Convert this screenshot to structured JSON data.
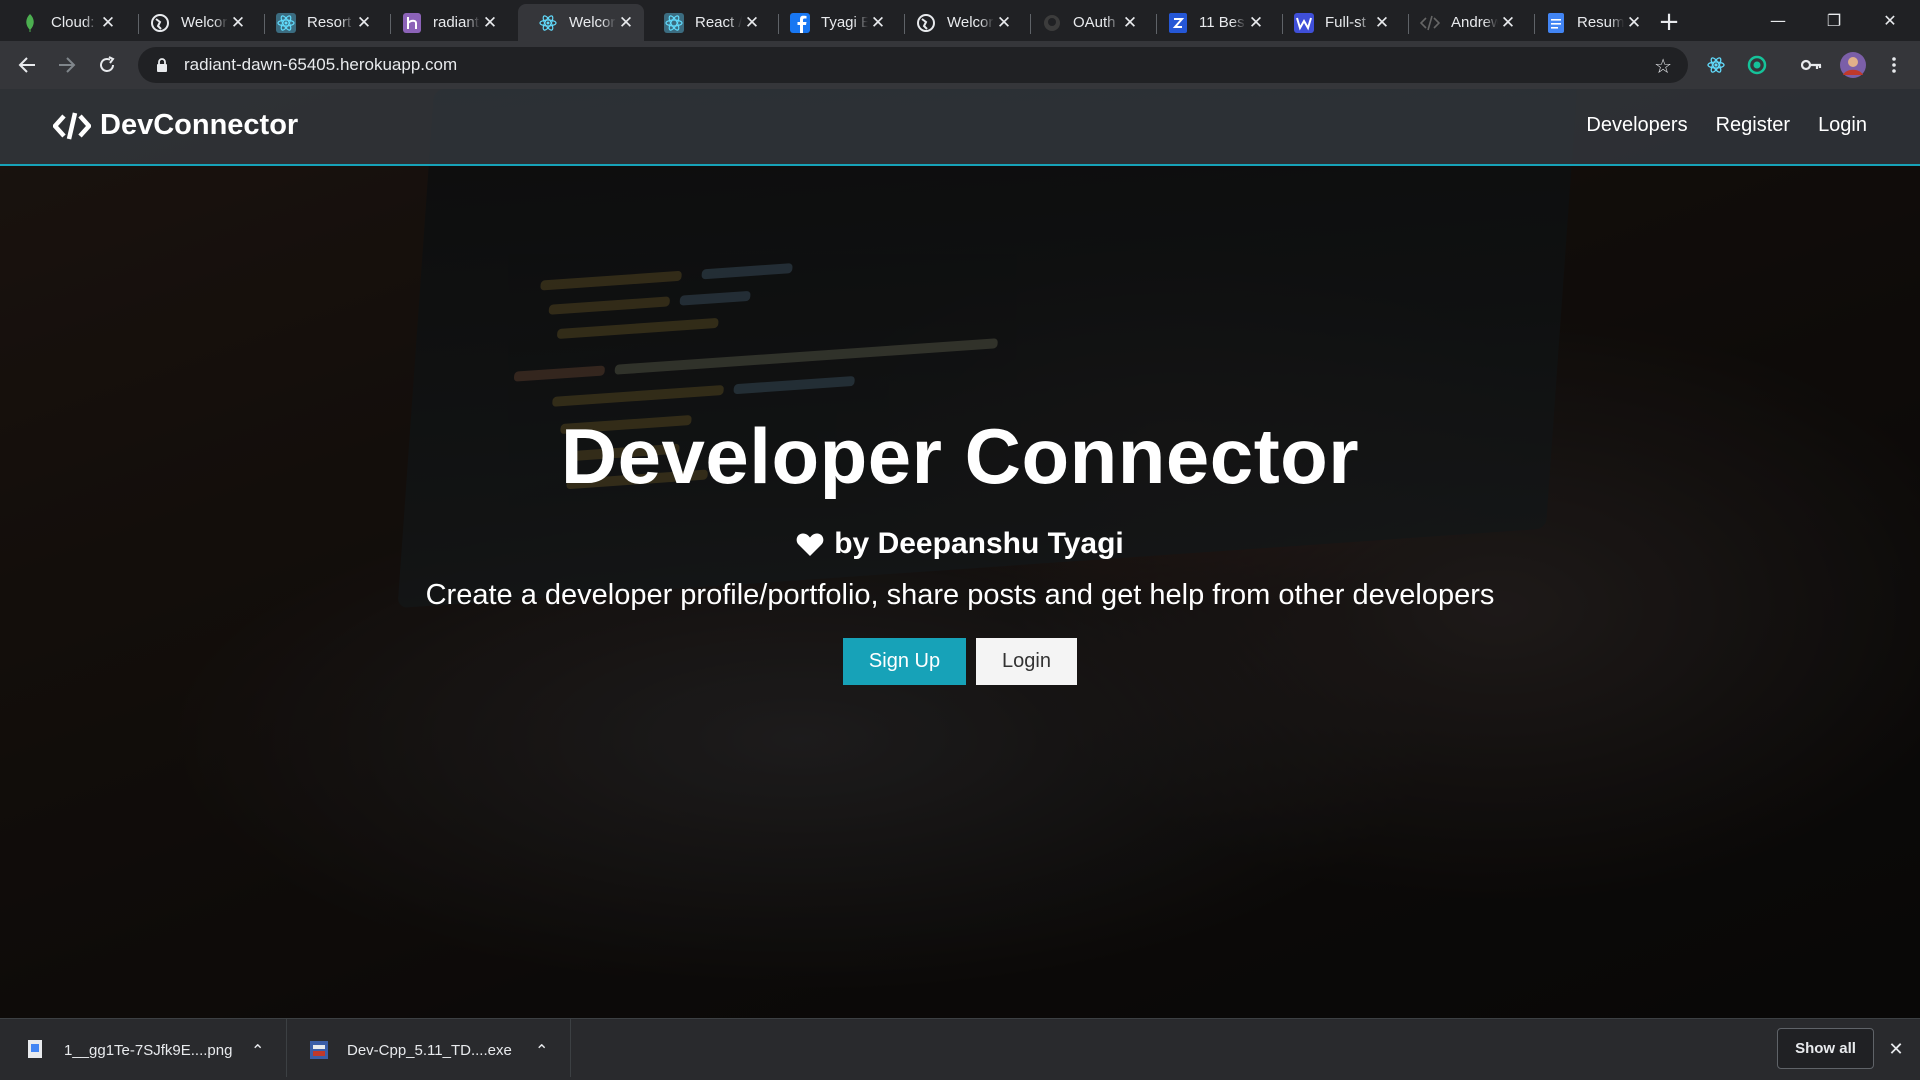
{
  "browser": {
    "tabs": [
      {
        "title": "Cloud:",
        "icon": "leaf-icon",
        "active": false
      },
      {
        "title": "Welcor",
        "icon": "globe-icon",
        "active": false
      },
      {
        "title": "Resort",
        "icon": "react-icon",
        "active": false
      },
      {
        "title": "radiant",
        "icon": "heroku-icon",
        "active": false
      },
      {
        "title": "Welcor",
        "icon": "react-icon",
        "active": true
      },
      {
        "title": "React /",
        "icon": "react-icon",
        "active": false
      },
      {
        "title": "Tyagi E",
        "icon": "facebook-icon",
        "active": false
      },
      {
        "title": "Welcor",
        "icon": "globe-icon",
        "active": false
      },
      {
        "title": "OAuth",
        "icon": "github-icon",
        "active": false
      },
      {
        "title": "11 Bes",
        "icon": "blue-logo-icon",
        "active": false
      },
      {
        "title": "Full-st",
        "icon": "w-logo-icon",
        "active": false
      },
      {
        "title": "Andrew",
        "icon": "code-icon",
        "active": false
      },
      {
        "title": "Resum",
        "icon": "docs-icon",
        "active": false
      }
    ],
    "url": "radiant-dawn-65405.herokuapp.com"
  },
  "site": {
    "brand": "DevConnector",
    "nav": {
      "developers": "Developers",
      "register": "Register",
      "login": "Login"
    },
    "hero": {
      "title": "Developer Connector",
      "byline": "by Deepanshu Tyagi",
      "lead": "Create a developer profile/portfolio, share posts and get help from other developers",
      "signup": "Sign Up",
      "login": "Login"
    },
    "colors": {
      "accent": "#17a2b8",
      "navbar": "#343a40",
      "light": "#f4f4f4"
    }
  },
  "downloads": {
    "items": [
      {
        "name": "1__gg1Te-7SJfk9E....png",
        "icon": "image-file-icon"
      },
      {
        "name": "Dev-Cpp_5.11_TD....exe",
        "icon": "exe-file-icon"
      }
    ],
    "show_all": "Show all"
  }
}
